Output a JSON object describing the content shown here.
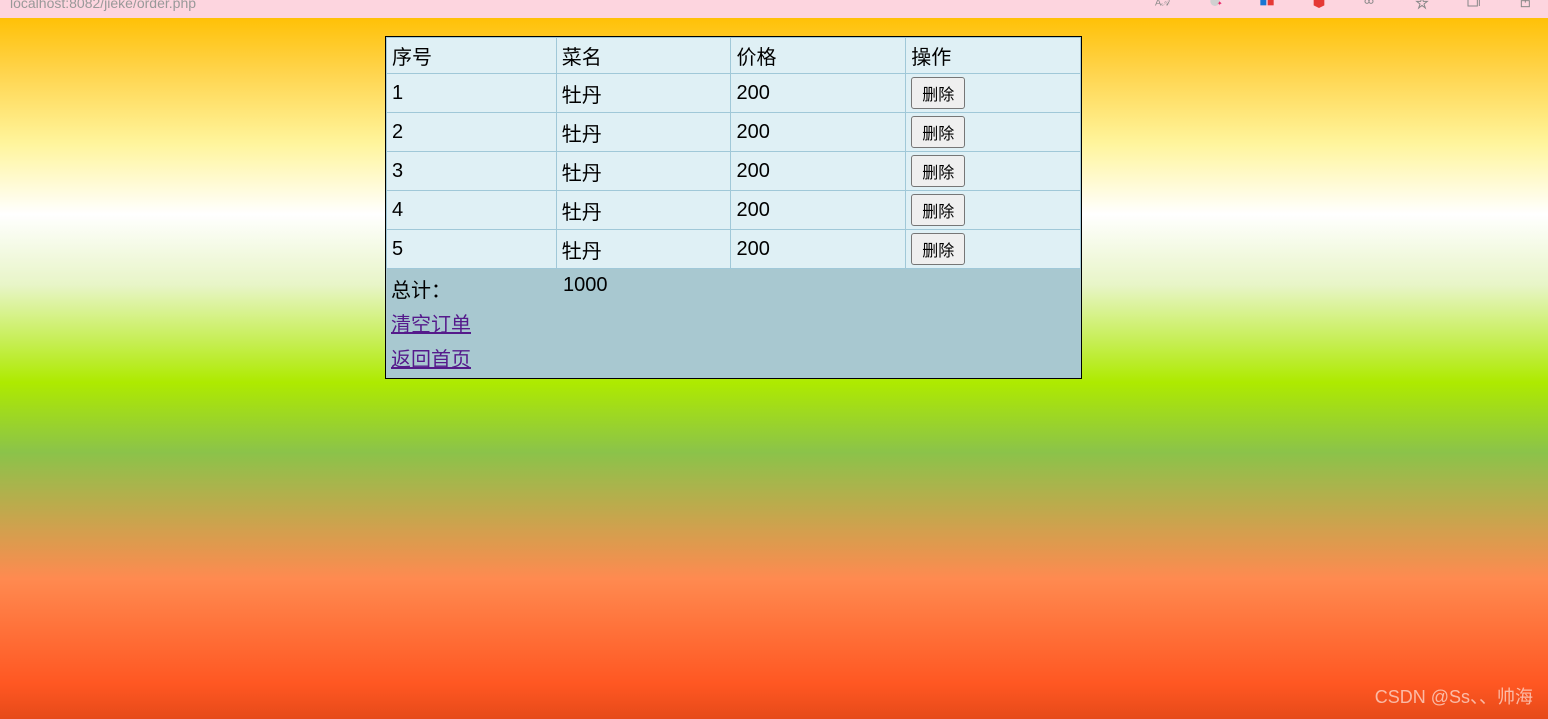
{
  "browser": {
    "url": "localhost:8082/jieke/order.php"
  },
  "table": {
    "headers": {
      "id": "序号",
      "name": "菜名",
      "price": "价格",
      "action": "操作"
    },
    "rows": [
      {
        "id": "1",
        "name": "牡丹",
        "price": "200",
        "action": "删除"
      },
      {
        "id": "2",
        "name": "牡丹",
        "price": "200",
        "action": "删除"
      },
      {
        "id": "3",
        "name": "牡丹",
        "price": "200",
        "action": "删除"
      },
      {
        "id": "4",
        "name": "牡丹",
        "price": "200",
        "action": "删除"
      },
      {
        "id": "5",
        "name": "牡丹",
        "price": "200",
        "action": "删除"
      }
    ]
  },
  "total": {
    "label": "总计：",
    "value": "1000"
  },
  "links": {
    "clear": "清空订单",
    "back": "返回首页"
  },
  "watermark": "CSDN @Ss、、帅海"
}
